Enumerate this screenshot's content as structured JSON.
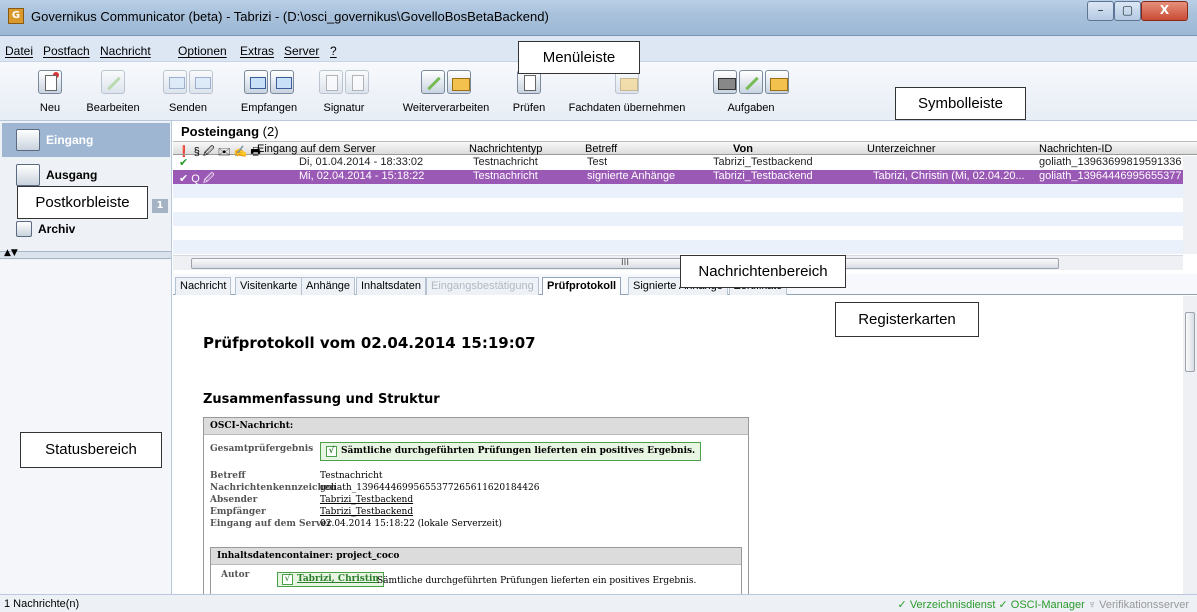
{
  "window": {
    "title": "Governikus Communicator (beta) - Tabrizi - (D:\\osci_governikus\\GovelloBosBetaBackend)",
    "app_icon": "G",
    "minimize": "–",
    "maximize": "▢",
    "close": "X"
  },
  "menu": [
    "Datei",
    "Postfach",
    "Nachricht",
    "Optionen",
    "Extras",
    "Server",
    "?"
  ],
  "toolbar": {
    "neu": "Neu",
    "bearbeiten": "Bearbeiten",
    "senden": "Senden",
    "empfangen": "Empfangen",
    "signatur": "Signatur",
    "weiterverarbeiten": "Weiterverarbeiten",
    "pruefen": "Prüfen",
    "fachdaten": "Fachdaten übernehmen",
    "aufgaben": "Aufgaben"
  },
  "sidebar": {
    "eingang": "Eingang",
    "ausgang": "Ausgang",
    "badge": "1",
    "archiv": "Archiv",
    "split_arrows": "▲▼"
  },
  "inbox": {
    "title": "Posteingang",
    "count": "(2)",
    "headers": {
      "icons": "❗ § 🖉 ✉ ✍ 🖶",
      "eingang": "Eingang auf dem Server",
      "typ": "Nachrichtentyp",
      "betreff": "Betreff",
      "von": "Von",
      "unterzeichner": "Unterzeichner",
      "id": "Nachrichten-ID"
    },
    "rows": [
      {
        "icons": "✔",
        "eingang": "Di, 01.04.2014 - 18:33:02",
        "typ": "Testnachricht",
        "betreff": "Test",
        "von": "Tabrizi_Testbackend",
        "unterzeichner": "",
        "id": "goliath_13963699819591336"
      },
      {
        "icons": "✔ Q 🖉",
        "eingang": "Mi, 02.04.2014 - 15:18:22",
        "typ": "Testnachricht",
        "betreff": "signierte Anhänge",
        "von": "Tabrizi_Testbackend",
        "unterzeichner": "Tabrizi, Christin (Mi, 02.04.20...",
        "id": "goliath_13964446995655377"
      }
    ],
    "hscroll_grip": "III"
  },
  "tabs": [
    "Nachricht",
    "Visitenkarte",
    "Anhänge",
    "Inhaltsdaten",
    "Eingangsbestätigung",
    "Prüfprotokoll",
    "Signierte Anhänge",
    "Zertifikate"
  ],
  "protocol": {
    "title": "Prüfprotokoll vom 02.04.2014 15:19:07",
    "summary_title": "Zusammenfassung und Struktur",
    "osci_head": "OSCI-Nachricht:",
    "gesamt_label": "Gesamtprüfergebnis",
    "check": "√",
    "gesamt_value": "Sämtliche durchgeführten Prüfungen lieferten ein positives Ergebnis.",
    "betreff_label": "Betreff",
    "betreff_value": "Testnachricht",
    "kennz_label": "Nachrichtenkennzeichen",
    "kennz_value": "goliath_13964446995655377265611620184426",
    "absender_label": "Absender",
    "absender_value": "Tabrizi_Testbackend",
    "empfaenger_label": "Empfänger",
    "empfaenger_value": "Tabrizi_Testbackend",
    "eingang_label": "Eingang auf dem Server",
    "eingang_value": "02.04.2014 15:18:22 (lokale Serverzeit)",
    "container_head": "Inhaltsdatencontainer: project_coco",
    "autor_label": "Autor",
    "autor_name": "Tabrizi, Christin",
    "autor_result": "Sämtliche durchgeführten Prüfungen lieferten ein positives Ergebnis."
  },
  "statusbar": {
    "left": "1 Nachrichte(n)",
    "verzeichnis": "✓ Verzeichnisdienst",
    "osci": "✓ OSCI-Manager",
    "verif": "♆ Verifikationsserver"
  },
  "callouts": {
    "menu": "Menüleiste",
    "symbol": "Symbolleiste",
    "postkorb": "Postkorbleiste",
    "nachrichten": "Nachrichtenbereich",
    "register": "Registerkarten",
    "status": "Statusbereich"
  },
  "colors": {
    "selected_row": "#9b59b6",
    "ok_green": "#49a049",
    "titlebar": "#a9c2dc"
  }
}
